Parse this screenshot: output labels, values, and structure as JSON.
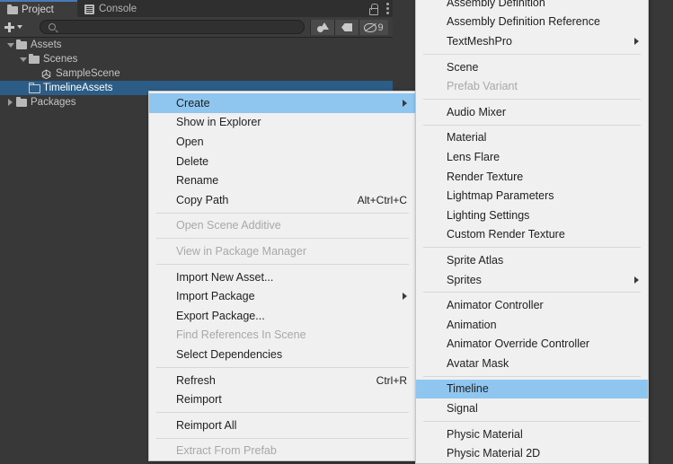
{
  "window": {
    "tabs": [
      {
        "label": "Project",
        "icon": "folder-icon",
        "active": true
      },
      {
        "label": "Console",
        "icon": "console-icon",
        "active": false
      }
    ],
    "lock_icon": "lock-icon",
    "menu_icon": "kebab-menu-icon"
  },
  "toolbar": {
    "add_label": "+",
    "add_icon": "plus-icon",
    "dropdown_icon": "chevron-down-icon",
    "search": {
      "value": "",
      "placeholder": "",
      "icon": "search-icon"
    },
    "filters": [
      {
        "name": "type-filter-icon",
        "label": ""
      },
      {
        "name": "label-filter-icon",
        "label": ""
      },
      {
        "name": "hidden-count-icon",
        "label": "9"
      }
    ]
  },
  "tree": [
    {
      "label": "Assets",
      "depth": 0,
      "twisty": "open",
      "icon": "folder-solid-icon",
      "selected": false
    },
    {
      "label": "Scenes",
      "depth": 1,
      "twisty": "open",
      "icon": "folder-solid-icon",
      "selected": false
    },
    {
      "label": "SampleScene",
      "depth": 2,
      "twisty": "none",
      "icon": "unity-scene-icon",
      "selected": false
    },
    {
      "label": "TimelineAssets",
      "depth": 1,
      "twisty": "none",
      "icon": "folder-outline-icon",
      "selected": true
    },
    {
      "label": "Packages",
      "depth": 0,
      "twisty": "closed",
      "icon": "folder-solid-icon",
      "selected": false
    }
  ],
  "context_menu": {
    "items": [
      {
        "label": "Create",
        "shortcut": "",
        "submenu": true,
        "disabled": false,
        "highlight": true
      },
      {
        "label": "Show in Explorer",
        "shortcut": "",
        "submenu": false,
        "disabled": false,
        "highlight": false
      },
      {
        "label": "Open",
        "shortcut": "",
        "submenu": false,
        "disabled": false,
        "highlight": false
      },
      {
        "label": "Delete",
        "shortcut": "",
        "submenu": false,
        "disabled": false,
        "highlight": false
      },
      {
        "label": "Rename",
        "shortcut": "",
        "submenu": false,
        "disabled": false,
        "highlight": false
      },
      {
        "label": "Copy Path",
        "shortcut": "Alt+Ctrl+C",
        "submenu": false,
        "disabled": false,
        "highlight": false
      },
      {
        "separator": true
      },
      {
        "label": "Open Scene Additive",
        "shortcut": "",
        "submenu": false,
        "disabled": true,
        "highlight": false
      },
      {
        "separator": true
      },
      {
        "label": "View in Package Manager",
        "shortcut": "",
        "submenu": false,
        "disabled": true,
        "highlight": false
      },
      {
        "separator": true
      },
      {
        "label": "Import New Asset...",
        "shortcut": "",
        "submenu": false,
        "disabled": false,
        "highlight": false
      },
      {
        "label": "Import Package",
        "shortcut": "",
        "submenu": true,
        "disabled": false,
        "highlight": false
      },
      {
        "label": "Export Package...",
        "shortcut": "",
        "submenu": false,
        "disabled": false,
        "highlight": false
      },
      {
        "label": "Find References In Scene",
        "shortcut": "",
        "submenu": false,
        "disabled": true,
        "highlight": false
      },
      {
        "label": "Select Dependencies",
        "shortcut": "",
        "submenu": false,
        "disabled": false,
        "highlight": false
      },
      {
        "separator": true
      },
      {
        "label": "Refresh",
        "shortcut": "Ctrl+R",
        "submenu": false,
        "disabled": false,
        "highlight": false
      },
      {
        "label": "Reimport",
        "shortcut": "",
        "submenu": false,
        "disabled": false,
        "highlight": false
      },
      {
        "separator": true
      },
      {
        "label": "Reimport All",
        "shortcut": "",
        "submenu": false,
        "disabled": false,
        "highlight": false
      },
      {
        "separator": true
      },
      {
        "label": "Extract From Prefab",
        "shortcut": "",
        "submenu": false,
        "disabled": true,
        "highlight": false
      }
    ]
  },
  "create_submenu": {
    "items": [
      {
        "label": "Assembly Definition",
        "submenu": false,
        "disabled": false,
        "highlight": false
      },
      {
        "label": "Assembly Definition Reference",
        "submenu": false,
        "disabled": false,
        "highlight": false
      },
      {
        "label": "TextMeshPro",
        "submenu": true,
        "disabled": false,
        "highlight": false
      },
      {
        "separator": true
      },
      {
        "label": "Scene",
        "submenu": false,
        "disabled": false,
        "highlight": false
      },
      {
        "label": "Prefab Variant",
        "submenu": false,
        "disabled": true,
        "highlight": false
      },
      {
        "separator": true
      },
      {
        "label": "Audio Mixer",
        "submenu": false,
        "disabled": false,
        "highlight": false
      },
      {
        "separator": true
      },
      {
        "label": "Material",
        "submenu": false,
        "disabled": false,
        "highlight": false
      },
      {
        "label": "Lens Flare",
        "submenu": false,
        "disabled": false,
        "highlight": false
      },
      {
        "label": "Render Texture",
        "submenu": false,
        "disabled": false,
        "highlight": false
      },
      {
        "label": "Lightmap Parameters",
        "submenu": false,
        "disabled": false,
        "highlight": false
      },
      {
        "label": "Lighting Settings",
        "submenu": false,
        "disabled": false,
        "highlight": false
      },
      {
        "label": "Custom Render Texture",
        "submenu": false,
        "disabled": false,
        "highlight": false
      },
      {
        "separator": true
      },
      {
        "label": "Sprite Atlas",
        "submenu": false,
        "disabled": false,
        "highlight": false
      },
      {
        "label": "Sprites",
        "submenu": true,
        "disabled": false,
        "highlight": false
      },
      {
        "separator": true
      },
      {
        "label": "Animator Controller",
        "submenu": false,
        "disabled": false,
        "highlight": false
      },
      {
        "label": "Animation",
        "submenu": false,
        "disabled": false,
        "highlight": false
      },
      {
        "label": "Animator Override Controller",
        "submenu": false,
        "disabled": false,
        "highlight": false
      },
      {
        "label": "Avatar Mask",
        "submenu": false,
        "disabled": false,
        "highlight": false
      },
      {
        "separator": true
      },
      {
        "label": "Timeline",
        "submenu": false,
        "disabled": false,
        "highlight": true
      },
      {
        "label": "Signal",
        "submenu": false,
        "disabled": false,
        "highlight": false
      },
      {
        "separator": true
      },
      {
        "label": "Physic Material",
        "submenu": false,
        "disabled": false,
        "highlight": false
      },
      {
        "label": "Physic Material 2D",
        "submenu": false,
        "disabled": false,
        "highlight": false
      }
    ]
  },
  "colors": {
    "panel_bg": "#383838",
    "tab_active_accent": "#4b79b8",
    "tree_selected": "#2c5d87",
    "menu_bg": "#f0f0f0",
    "menu_highlight": "#8FC6F0",
    "menu_text": "#1e1e1e",
    "menu_disabled": "#a8a8a8"
  }
}
